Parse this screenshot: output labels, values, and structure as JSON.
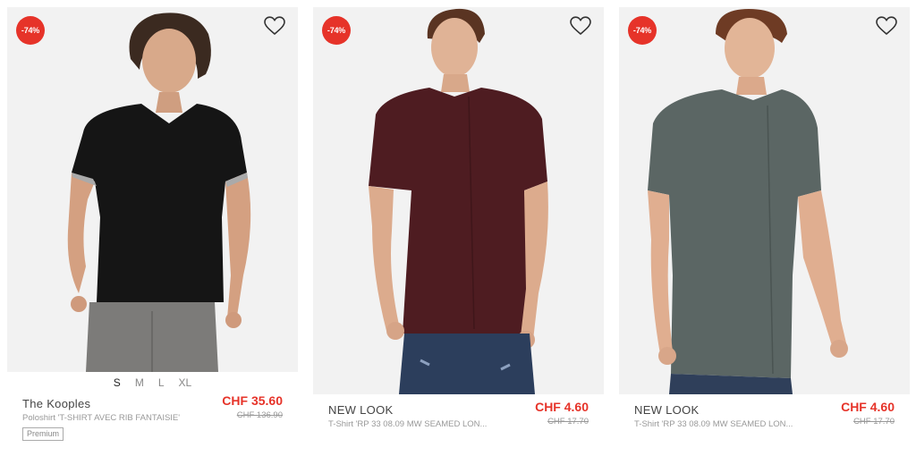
{
  "colors": {
    "accent": "#e63329",
    "background": "#f2f2f2"
  },
  "products": [
    {
      "discount": "-74%",
      "brand": "The Kooples",
      "name": "Poloshirt 'T-SHIRT AVEC RIB FANTAISIE'",
      "price": "CHF 35.60",
      "old_price": "CHF 136.90",
      "tag": "Premium",
      "sizes": [
        "S",
        "M",
        "L",
        "XL"
      ],
      "wishlist_icon": "heart-icon"
    },
    {
      "discount": "-74%",
      "brand": "NEW LOOK",
      "name": "T-Shirt 'RP 33 08.09 MW SEAMED LON...",
      "price": "CHF 4.60",
      "old_price": "CHF 17.70",
      "wishlist_icon": "heart-icon"
    },
    {
      "discount": "-74%",
      "brand": "NEW LOOK",
      "name": "T-Shirt 'RP 33 08.09 MW SEAMED LON...",
      "price": "CHF 4.60",
      "old_price": "CHF 17.70",
      "wishlist_icon": "heart-icon"
    }
  ]
}
